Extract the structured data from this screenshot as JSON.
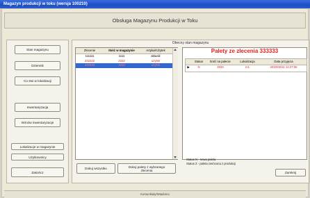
{
  "window": {
    "title": "Magazyn produkcji w toku  (wersja 100210)"
  },
  "header": {
    "title": "Obsługa Magazynu Produkcji w Toku"
  },
  "sidebar": {
    "buttons": [
      "Stan magazynu",
      "Dziennik",
      "Co stoi w lokalizacji",
      "Inwentaryzacja",
      "Wznów inwentaryzacje",
      "Lokalizacje w magazynie",
      "Użytkownicy",
      "Zakończ"
    ]
  },
  "main": {
    "title": "Obecny stan magazynu",
    "list": {
      "columns": [
        "Zlecenie",
        "Ilość w magazynie",
        "Artykuł/Użytek"
      ],
      "rows": [
        [
          "111111",
          "1111",
          "aktualz"
        ],
        [
          "222222",
          "2222",
          "uzytek"
        ],
        [
          "333333",
          "3333",
          "uzytek"
        ]
      ]
    },
    "btn_all": "Dokuj wszystko",
    "btn_selected": "Dokuj palety z wybranego zlecenia"
  },
  "details": {
    "title": "Palety ze zlecenia 333333",
    "columns": [
      "Status",
      "Ilość na palecie",
      "Lokalizacja",
      "Data przyjęcia"
    ],
    "rows": [
      [
        "N",
        "3333",
        "m1",
        "2010/02/11 14:27:06"
      ]
    ],
    "status_lines": [
      "Status N - nowa paleta",
      "Status Z - paleta zwrócona z produkcji"
    ],
    "close": "Zamknij"
  },
  "footer": {
    "text": "Komunikaty/Wiadomo"
  }
}
